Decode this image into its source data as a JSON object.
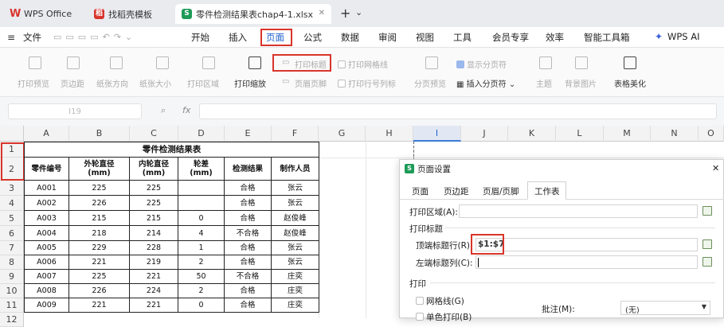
{
  "tabs": [
    {
      "label": "WPS Office",
      "icon": "wps-logo-icon"
    },
    {
      "label": "找稻壳模板",
      "icon": "docer-icon"
    },
    {
      "label": "零件检测结果表chap4-1.xlsx",
      "icon": "sheet-file-icon"
    }
  ],
  "window_controls": {
    "add": "+",
    "more": "⌄"
  },
  "menu": {
    "file": "文件",
    "items": [
      "开始",
      "插入",
      "页面",
      "公式",
      "数据",
      "审阅",
      "视图",
      "工具",
      "会员专享",
      "效率",
      "智能工具箱"
    ],
    "active": "页面",
    "ai": "WPS AI"
  },
  "ribbon": {
    "print_preview": "打印预览",
    "margins": "页边距",
    "orientation": "纸张方向",
    "size": "纸张大小",
    "print_area": "打印区域",
    "print_scale": "打印缩放",
    "print_titles": "打印标题",
    "header_footer": "页眉页脚",
    "print_gridlines": "打印网格线",
    "print_row_col": "打印行号列标",
    "page_preview": "分页预览",
    "show_breaks": "显示分页符",
    "insert_break": "插入分页符",
    "theme": "主题",
    "bg_image": "背景图片",
    "beautify": "表格美化"
  },
  "formula_bar": {
    "name_box": "I19",
    "fx": "fx"
  },
  "columns": [
    "A",
    "B",
    "C",
    "D",
    "E",
    "F",
    "G",
    "H",
    "I",
    "J",
    "K",
    "L",
    "M",
    "N",
    "O"
  ],
  "selected_column": "I",
  "rows": [
    "1",
    "2",
    "3",
    "4",
    "5",
    "6",
    "7",
    "8",
    "9",
    "10",
    "11",
    "12"
  ],
  "table": {
    "title": "零件检测结果表",
    "headers": [
      "零件编号",
      "外轮直径\n(mm)",
      "内轮直径\n(mm)",
      "轮差\n(mm)",
      "检测结果",
      "制作人员"
    ],
    "data": [
      [
        "A001",
        "225",
        "225",
        "",
        "合格",
        "张云"
      ],
      [
        "A002",
        "226",
        "225",
        "",
        "合格",
        "张云"
      ],
      [
        "A003",
        "215",
        "215",
        "0",
        "合格",
        "赵俊峰"
      ],
      [
        "A004",
        "218",
        "214",
        "4",
        "不合格",
        "赵俊峰"
      ],
      [
        "A005",
        "229",
        "228",
        "1",
        "合格",
        "张云"
      ],
      [
        "A006",
        "221",
        "219",
        "2",
        "合格",
        "张云"
      ],
      [
        "A007",
        "225",
        "221",
        "50",
        "不合格",
        "庄奕"
      ],
      [
        "A008",
        "226",
        "224",
        "2",
        "合格",
        "庄奕"
      ],
      [
        "A009",
        "221",
        "221",
        "0",
        "合格",
        "庄奕"
      ]
    ]
  },
  "dialog": {
    "icon": "S",
    "title": "页面设置",
    "close": "✕",
    "tabs": [
      "页面",
      "页边距",
      "页眉/页脚",
      "工作表"
    ],
    "active_tab": "工作表",
    "print_area_label": "打印区域(A):",
    "print_area_value": "",
    "print_titles_section": "打印标题",
    "top_rows_label": "顶端标题行(R):",
    "top_rows_value": "$1:$7",
    "left_cols_label": "左端标题列(C):",
    "left_cols_value": "",
    "print_section": "打印",
    "gridlines_label": "网格线(G)",
    "mono_label": "单色打印(B)",
    "comments_label": "批注(M):",
    "comments_value": "(无)"
  }
}
